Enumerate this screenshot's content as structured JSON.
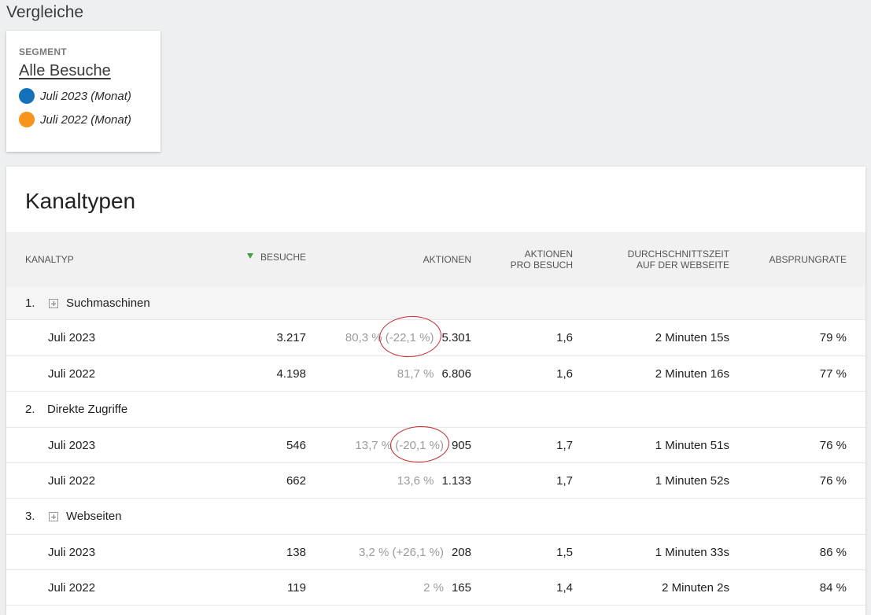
{
  "page_title": "Vergleiche",
  "comparison": {
    "segment_label": "SEGMENT",
    "segment_name": "Alle Besuche",
    "periods": [
      {
        "label": "Juli 2023 (Monat)",
        "color": "#1472bb"
      },
      {
        "label": "Juli 2022 (Monat)",
        "color": "#f7941d"
      }
    ]
  },
  "report": {
    "title": "Kanaltypen",
    "columns": {
      "kanaltyp": "KANALTYP",
      "besuche": "BESUCHE",
      "aktionen": "AKTIONEN",
      "aktionen_pro_besuch_1": "AKTIONEN",
      "aktionen_pro_besuch_2": "PRO BESUCH",
      "durchschnittszeit_1": "DURCHSCHNITTSZEIT",
      "durchschnittszeit_2": "AUF DER WEBSEITE",
      "absprungrate": "ABSPRUNGRATE"
    },
    "groups": [
      {
        "index": "1.",
        "name": "Suchmaschinen",
        "expandable": true,
        "rows": [
          {
            "period": "Juli 2023",
            "besuche": "3.217",
            "share": "80,3 % (-22,1 %)",
            "aktionen": "5.301",
            "apb": "1,6",
            "zeit": "2 Minuten 15s",
            "absprung": "79 %"
          },
          {
            "period": "Juli 2022",
            "besuche": "4.198",
            "share": "81,7 %",
            "aktionen": "6.806",
            "apb": "1,6",
            "zeit": "2 Minuten 16s",
            "absprung": "77 %"
          }
        ]
      },
      {
        "index": "2.",
        "name": "Direkte Zugriffe",
        "expandable": false,
        "rows": [
          {
            "period": "Juli 2023",
            "besuche": "546",
            "share": "13,7 % (-20,1 %)",
            "aktionen": "905",
            "apb": "1,7",
            "zeit": "1 Minuten 51s",
            "absprung": "76 %"
          },
          {
            "period": "Juli 2022",
            "besuche": "662",
            "share": "13,6 %",
            "aktionen": "1.133",
            "apb": "1,7",
            "zeit": "1 Minuten 52s",
            "absprung": "76 %"
          }
        ]
      },
      {
        "index": "3.",
        "name": "Webseiten",
        "expandable": true,
        "rows": [
          {
            "period": "Juli 2023",
            "besuche": "138",
            "share": "3,2 % (+26,1 %)",
            "aktionen": "208",
            "apb": "1,5",
            "zeit": "1 Minuten 33s",
            "absprung": "86 %"
          },
          {
            "period": "Juli 2022",
            "besuche": "119",
            "share": "2 %",
            "aktionen": "165",
            "apb": "1,4",
            "zeit": "2 Minuten 2s",
            "absprung": "84 %"
          }
        ]
      }
    ]
  }
}
